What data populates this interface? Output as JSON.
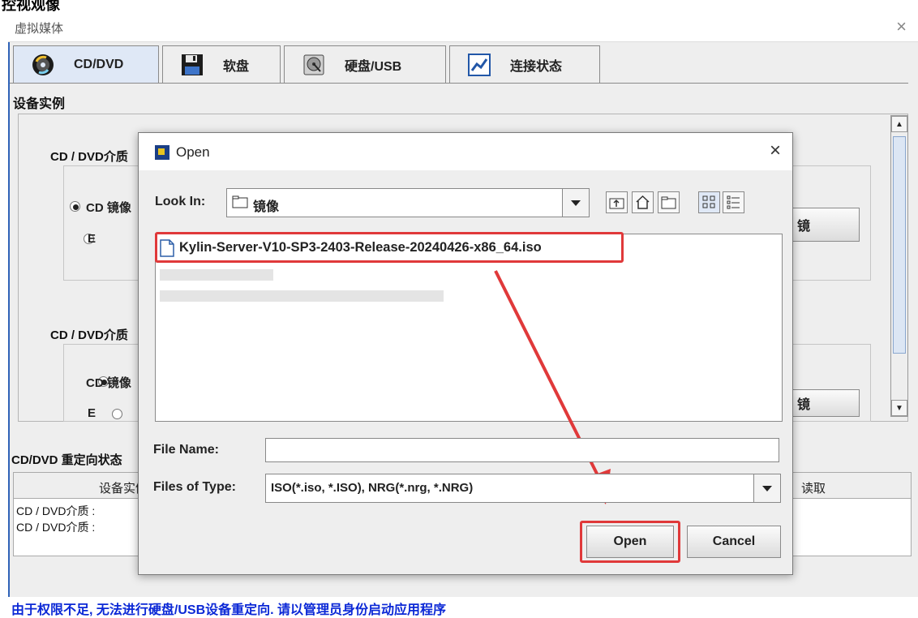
{
  "window": {
    "title": "虚拟媒体",
    "close": "×",
    "partial_heading": "控视观像"
  },
  "tabs": [
    {
      "label": "CD/DVD",
      "icon": "disc-icon",
      "active": true
    },
    {
      "label": "软盘",
      "icon": "floppy-icon",
      "active": false
    },
    {
      "label": "硬盘/USB",
      "icon": "harddisk-icon",
      "active": false
    },
    {
      "label": "连接状态",
      "icon": "chart-icon",
      "active": false
    }
  ],
  "instance": {
    "heading": "设备实例",
    "groups": [
      {
        "title": "CD / DVD介质",
        "radio1": "CD 镜像",
        "radio2": "E",
        "button_fragment": "镜"
      },
      {
        "title": "CD / DVD介质",
        "radio1": "CD 镜像",
        "radio2": "E",
        "button_fragment": "镜"
      }
    ]
  },
  "redirect": {
    "heading": "CD/DVD 重定向状态",
    "col_device": "设备实例",
    "col_read": "读取",
    "rows": [
      "CD / DVD介质 :",
      "CD / DVD介质 :"
    ]
  },
  "status_bar": "由于权限不足, 无法进行硬盘/USB设备重定向. 请以管理员身份启动应用程序",
  "dialog": {
    "title": "Open",
    "close": "×",
    "look_in_label": "Look In:",
    "look_in_value": "镜像",
    "files": [
      {
        "name": "Kylin-Server-V10-SP3-2403-Release-20240426-x86_64.iso",
        "selected": true
      }
    ],
    "file_name_label": "File Name:",
    "file_name_value": "",
    "file_type_label": "Files of Type:",
    "file_type_value": "ISO(*.iso, *.ISO), NRG(*.nrg, *.NRG)",
    "open_button": "Open",
    "cancel_button": "Cancel"
  },
  "colors": {
    "highlight": "#e0393a",
    "status_text": "#0b28d6",
    "active_tab": "#dfe8f6"
  }
}
